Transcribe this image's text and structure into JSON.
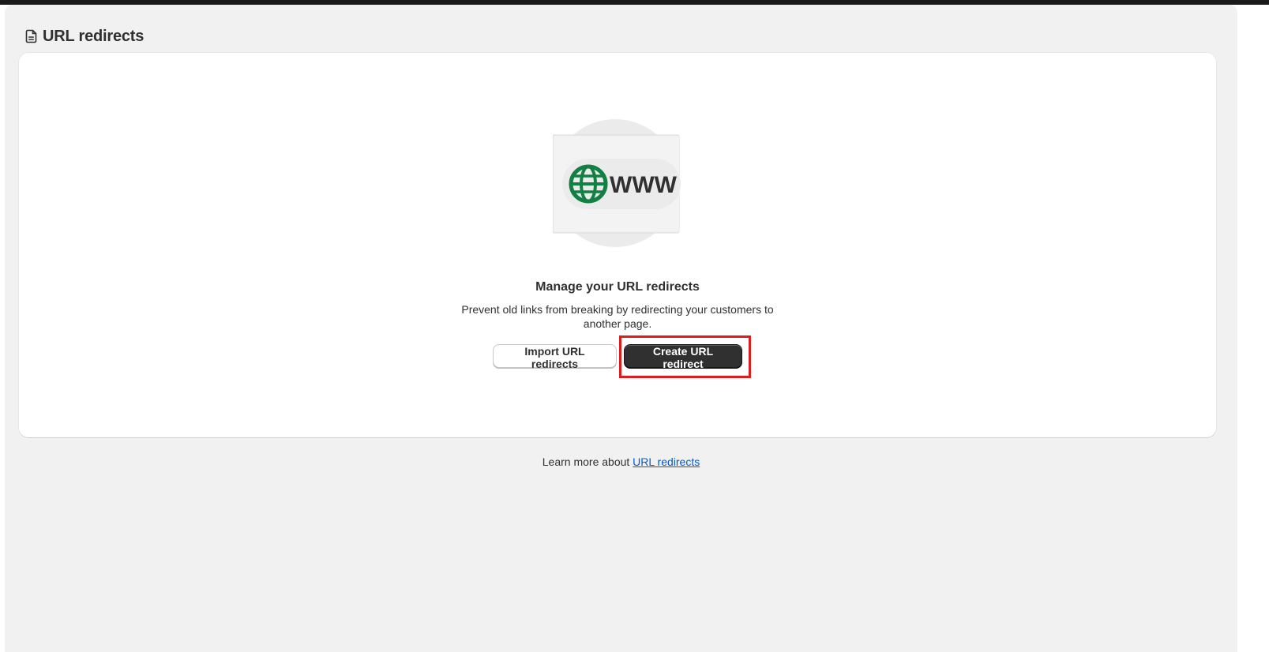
{
  "header": {
    "title": "URL redirects",
    "icon": "page-icon"
  },
  "empty_state": {
    "illustration_text": "WWW",
    "illustration_icon": "globe-icon",
    "heading": "Manage your URL redirects",
    "description": "Prevent old links from breaking by redirecting your customers to another page.",
    "secondary_action": "Import URL redirects",
    "primary_action": "Create URL redirect"
  },
  "footer": {
    "learn_more_prefix": "Learn more about ",
    "learn_more_link": "URL redirects"
  },
  "colors": {
    "accent_green": "#108043",
    "primary_button": "#303030",
    "link": "#005bd3",
    "highlight": "#e01b1b",
    "page_background": "#f1f1f1"
  }
}
